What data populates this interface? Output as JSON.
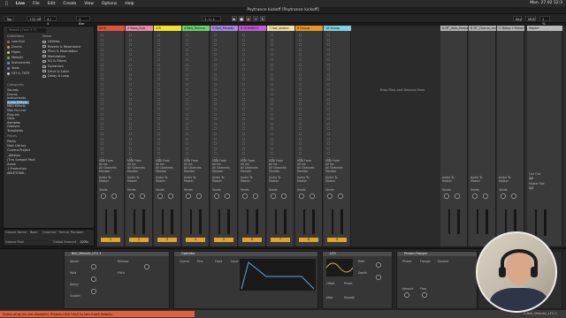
{
  "menubar": {
    "app": "Live",
    "items": [
      "File",
      "Edit",
      "Create",
      "View",
      "Options",
      "Help"
    ],
    "clock": "Mon. 27.02 12:3"
  },
  "title": "Psytrance kickoff  [Psytrance kickoff]",
  "transport": {
    "tap": "Tap",
    "tempo": "132.00",
    "signature": "4 / 4",
    "quantize": "1 Bar",
    "position": "1.  1.  1",
    "key": "Key",
    "midi": "MIDI",
    "zoom": "1 %"
  },
  "browser": {
    "search_placeholder": "Search (Cmd + F)",
    "collections_header": "Collections",
    "name_header": "Name",
    "collections": [
      {
        "label": "Low End",
        "color": "#e0533a"
      },
      {
        "label": "Drums",
        "color": "#e99a2a"
      },
      {
        "label": "Highs",
        "color": "#e6d23a"
      },
      {
        "label": "Melodic",
        "color": "#5bbd4a"
      },
      {
        "label": "Instruments",
        "color": "#4aa3d8"
      },
      {
        "label": "Tools",
        "color": "#9a6ad6"
      },
      {
        "label": "FX? & TXTR",
        "color": "#cfcfcf"
      }
    ],
    "categories_header": "Categories",
    "categories": [
      "Sounds",
      "Drums",
      "Instruments",
      "Audio Effects",
      "MIDI Effects",
      "Max for Live",
      "Plug-Ins",
      "Clips",
      "Samples",
      "Grooves",
      "Templates"
    ],
    "selected_category": "Audio Effects",
    "places_header": "Places",
    "places": [
      "Packs",
      "User Library",
      "Current Project",
      "_Ableton",
      "(Tm) Sample Pack",
      "Zoom",
      "1 Production",
      "ABLETONB..."
    ],
    "folders": [
      "Utilities",
      "Reverb & Resonance",
      "Pitch & Modulation",
      "Modulators",
      "EQ & Filters",
      "Dynamics",
      "Drive & Color",
      "Delay & Loop"
    ],
    "groove": {
      "name": "Groove Name",
      "base": "Base",
      "quantize": "Quantize",
      "timing": "Timing",
      "random": "Random",
      "pool": "Groove Pool",
      "global": "Global Amount",
      "global_value": "100%"
    }
  },
  "tracks": [
    {
      "name": "KICK",
      "color": "#e0533a",
      "num": "1"
    },
    {
      "name": "2 Bass_Sub",
      "color": "#e88aa8",
      "num": "2"
    },
    {
      "name": "3 B",
      "color": "#f3e12e",
      "num": "3"
    },
    {
      "name": "4 Bell_Techno",
      "color": "#6ad267",
      "num": "4"
    },
    {
      "name": "5 Bell_Melodic",
      "color": "#a88ae8",
      "num": "5"
    },
    {
      "name": "6 DOMINOS",
      "color": "#c55ad7",
      "num": "6"
    },
    {
      "name": "7 Hat_shaker",
      "color": "#f0e3a3",
      "num": "7"
    },
    {
      "name": "8 Group",
      "color": "#e8962a",
      "num": "8"
    },
    {
      "name": "18 Group",
      "color": "#7fd3e0",
      "num": "9"
    }
  ],
  "return_tracks": [
    {
      "name": "A RT_Verb_Reduc",
      "color": "#b0b0b0"
    },
    {
      "name": "B RT_Chorus_rev",
      "color": "#b0b0b0"
    },
    {
      "name": "C Delay 1 Return",
      "color": "#b0b0b0"
    }
  ],
  "master": {
    "name": "Master",
    "cue_out": "Cue Out",
    "cue_value": "1/2",
    "master_out": "Master Out",
    "master_value": "1/2"
  },
  "mixer_labels": {
    "midi_from": "MIDI From",
    "all_ins": "All Ins",
    "all_channels": "All Channels",
    "monitor": "Monitor",
    "in": "In",
    "auto": "Auto",
    "off": "Off",
    "audio_to": "Audio To",
    "master": "Master",
    "sends": "Sends"
  },
  "drop_hint": "Drop Files and Devices Here",
  "devices": [
    {
      "name": "Bell_Melodic_LFO 1",
      "labels": [
        "Attack",
        "Hold",
        "Decay",
        "Sustain",
        "Release",
        "Pitch"
      ]
    },
    {
      "name": "Operator",
      "labels": [
        "Coarse",
        "Fine",
        "Fixed",
        "Level"
      ]
    },
    {
      "name": "LFO",
      "labels": [
        "Rate",
        "Depth",
        "Offset",
        "Phase",
        "Jitter",
        "Smooth"
      ]
    },
    {
      "name": "Phaser-Flanger",
      "labels": [
        "Phaser",
        "Flanger",
        "Doubler",
        "Amount",
        "Freq",
        "Warmth",
        "Dry/Wet"
      ]
    }
  ],
  "status": {
    "message": "Some plug-ins are disabled. Please click here to see more details.",
    "track": "5-Bell_Melodic_LFO 1"
  }
}
